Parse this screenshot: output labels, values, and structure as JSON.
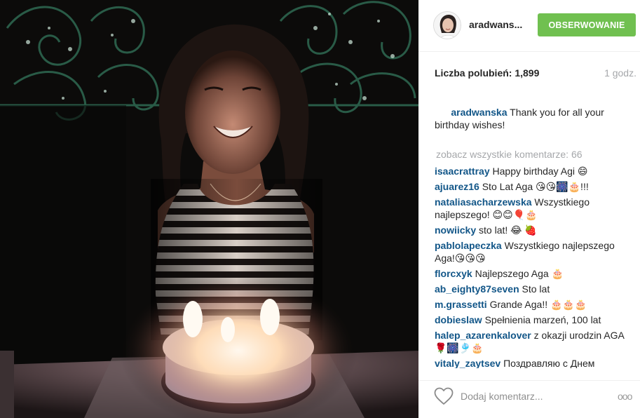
{
  "post": {
    "author": "aradwans...",
    "follow_label": "OBSERWOWANIE",
    "likes_label": "Liczba polubień: 1,899",
    "time_ago": "1 godz.",
    "caption": {
      "user": "aradwanska",
      "text": "Thank you for all your birthday wishes!"
    },
    "view_all_comments": "zobacz wszystkie komentarze: 66",
    "comment_placeholder": "Dodaj komentarz...",
    "more_options": "ooo"
  },
  "comments": [
    {
      "user": "isaacrattray",
      "text": "Happy birthday Agi 😄"
    },
    {
      "user": "ajuarez16",
      "text": "Sto Lat Aga 😘😘🎆🎂!!!"
    },
    {
      "user": "nataliasacharzewska",
      "text": "Wszystkiego najlepszego! 😊😊🎈🎂"
    },
    {
      "user": "nowiicky",
      "text": "sto lat! 😂 🍓"
    },
    {
      "user": "pablolapeczka",
      "text": "Wszystkiego najlepszego Aga!😘😘😘"
    },
    {
      "user": "florcxyk",
      "text": "Najlepszego Aga 🎂"
    },
    {
      "user": "ab_eighty87seven",
      "text": "Sto lat"
    },
    {
      "user": "m.grassetti",
      "text": "Grande Aga!! 🎂🎂🎂"
    },
    {
      "user": "dobieslaw",
      "text": "Spełnienia marzeń, 100 lat"
    },
    {
      "user": "halep_azarenkalover",
      "text": "z okazji urodzin AGA 🌹🎆🎐🎂"
    },
    {
      "user": "vitaly_zaytsev",
      "text": "Поздравляю с Днем"
    }
  ],
  "icons": {
    "heart": "heart-outline-icon",
    "more": "more-options-icon"
  },
  "colors": {
    "follow_button": "#70c050",
    "username": "#125688",
    "muted": "#a5a7aa"
  }
}
